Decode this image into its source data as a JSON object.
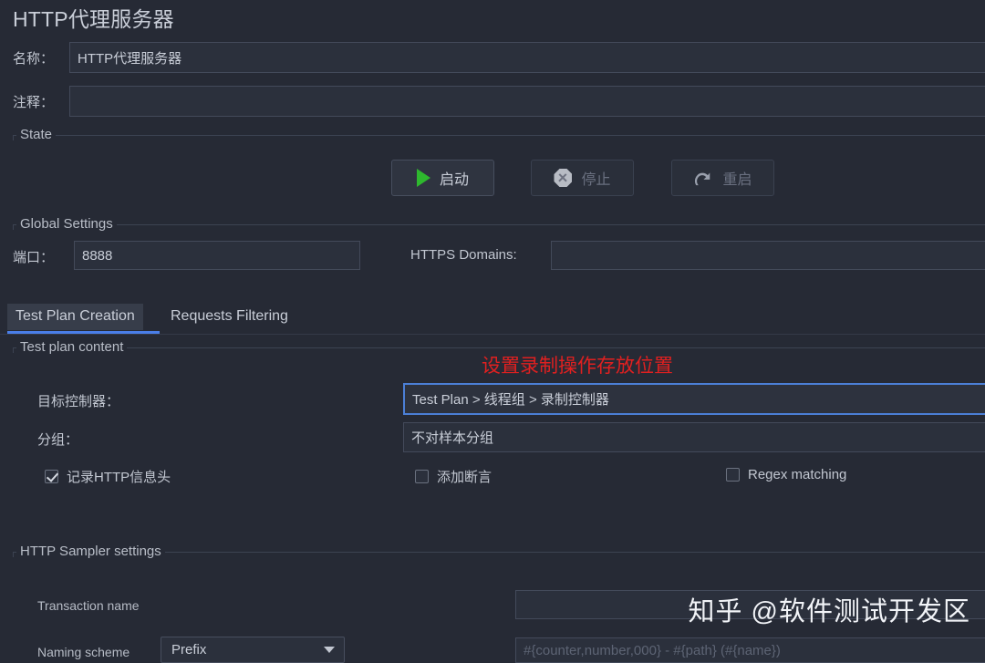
{
  "window": {
    "title": "HTTP代理服务器"
  },
  "form": {
    "name_label": "名称：",
    "name_value": "HTTP代理服务器",
    "comment_label": "注释：",
    "comment_value": ""
  },
  "state": {
    "group_title": "State",
    "buttons": [
      {
        "label": "启动",
        "icon": "play-icon",
        "enabled": true
      },
      {
        "label": "停止",
        "icon": "stop-icon",
        "enabled": false
      },
      {
        "label": "重启",
        "icon": "restart-icon",
        "enabled": false
      }
    ]
  },
  "global_settings": {
    "group_title": "Global Settings",
    "port_label": "端口：",
    "port_value": "8888",
    "https_domains_label": "HTTPS Domains:",
    "https_domains_value": ""
  },
  "tabs": [
    {
      "label": "Test Plan Creation",
      "active": true
    },
    {
      "label": "Requests Filtering",
      "active": false
    }
  ],
  "test_plan_content": {
    "group_title": "Test plan content",
    "annotation": "设置录制操作存放位置",
    "target_controller_label": "目标控制器：",
    "target_controller_value": "Test Plan > 线程组 > 录制控制器",
    "grouping_label": "分组：",
    "grouping_value": "不对样本分组",
    "checkboxes": [
      {
        "label": "记录HTTP信息头",
        "checked": true
      },
      {
        "label": "添加断言",
        "checked": false
      },
      {
        "label": "Regex matching",
        "checked": false
      }
    ]
  },
  "http_sampler_settings": {
    "group_title": "HTTP Sampler settings",
    "transaction_name_label": "Transaction name",
    "transaction_name_value": "",
    "naming_scheme_label": "Naming scheme",
    "naming_scheme_value": "Prefix",
    "naming_pattern_placeholder": "#{counter,number,000} - #{path} (#{name})",
    "naming_pattern_value": ""
  },
  "watermark": {
    "text": "知乎 @软件测试开发区"
  },
  "colors": {
    "background": "#262a35",
    "field_bg": "#2b303c",
    "accent_blue": "#4a7ee8",
    "focus_blue": "#4b7fd6",
    "annotation_red": "#e02020",
    "play_green": "#2eb82e",
    "text": "#c9ced8"
  }
}
